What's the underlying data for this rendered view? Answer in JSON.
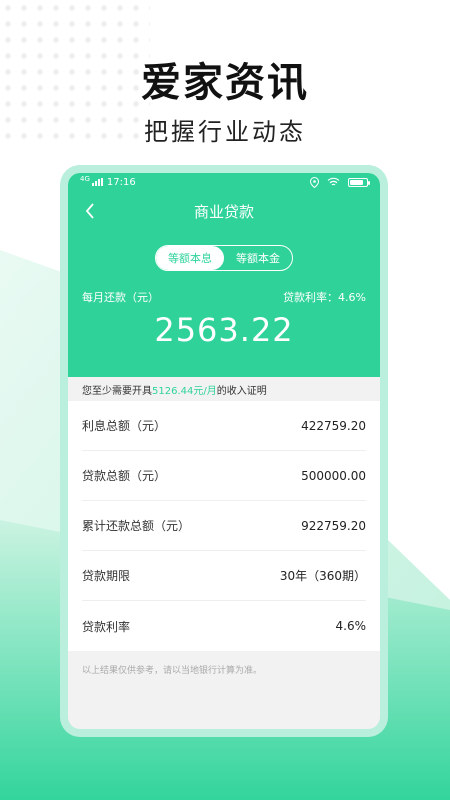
{
  "promo": {
    "headline": "爱家资讯",
    "subheadline": "把握行业动态"
  },
  "status_bar": {
    "network": "4G",
    "time": "17:16"
  },
  "nav": {
    "title": "商业贷款",
    "back_icon": "chevron-left-icon"
  },
  "tabs": [
    {
      "label": "等额本息",
      "selected": true
    },
    {
      "label": "等额本金",
      "selected": false
    }
  ],
  "summary": {
    "monthly_label": "每月还款（元）",
    "rate_label": "贷款利率：4.6%",
    "monthly_amount": "2563.22"
  },
  "notice": {
    "prefix": "您至少需要开具",
    "highlight": "5126.44元/月",
    "suffix": "的收入证明"
  },
  "details": [
    {
      "label": "利息总额（元）",
      "value": "422759.20"
    },
    {
      "label": "贷款总额（元）",
      "value": "500000.00"
    },
    {
      "label": "累计还款总额（元）",
      "value": "922759.20"
    },
    {
      "label": "贷款期限",
      "value": "30年（360期）"
    },
    {
      "label": "贷款利率",
      "value": "4.6%"
    }
  ],
  "footnote": "以上结果仅供参考，请以当地银行计算为准。",
  "colors": {
    "accent": "#2fd39a",
    "frame": "#b9efdc"
  }
}
